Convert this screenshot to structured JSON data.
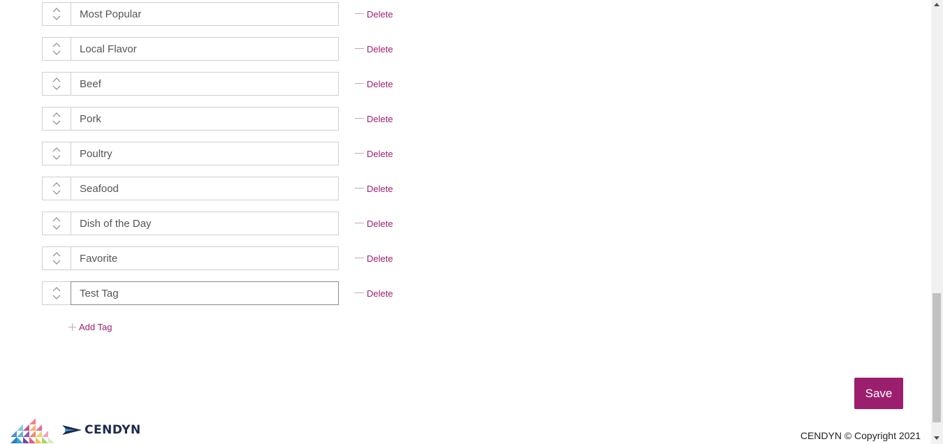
{
  "tags": [
    {
      "value": "Most Popular",
      "delete_label": "Delete"
    },
    {
      "value": "Local Flavor",
      "delete_label": "Delete"
    },
    {
      "value": "Beef",
      "delete_label": "Delete"
    },
    {
      "value": "Pork",
      "delete_label": "Delete"
    },
    {
      "value": "Poultry",
      "delete_label": "Delete"
    },
    {
      "value": "Seafood",
      "delete_label": "Delete"
    },
    {
      "value": "Dish of the Day",
      "delete_label": "Delete"
    },
    {
      "value": "Favorite",
      "delete_label": "Delete"
    },
    {
      "value": "Test Tag",
      "delete_label": "Delete"
    }
  ],
  "add_tag_label": "Add Tag",
  "save_label": "Save",
  "footer": {
    "brand": "CENDYN",
    "copyright": "CENDYN © Copyright 2021"
  },
  "colors": {
    "accent": "#9b1f6e",
    "link": "#9e1f6f",
    "border": "#cfcfcf"
  },
  "icons": {
    "reorder": "reorder-handle-icon",
    "delete": "minus-icon",
    "add": "plus-icon"
  }
}
